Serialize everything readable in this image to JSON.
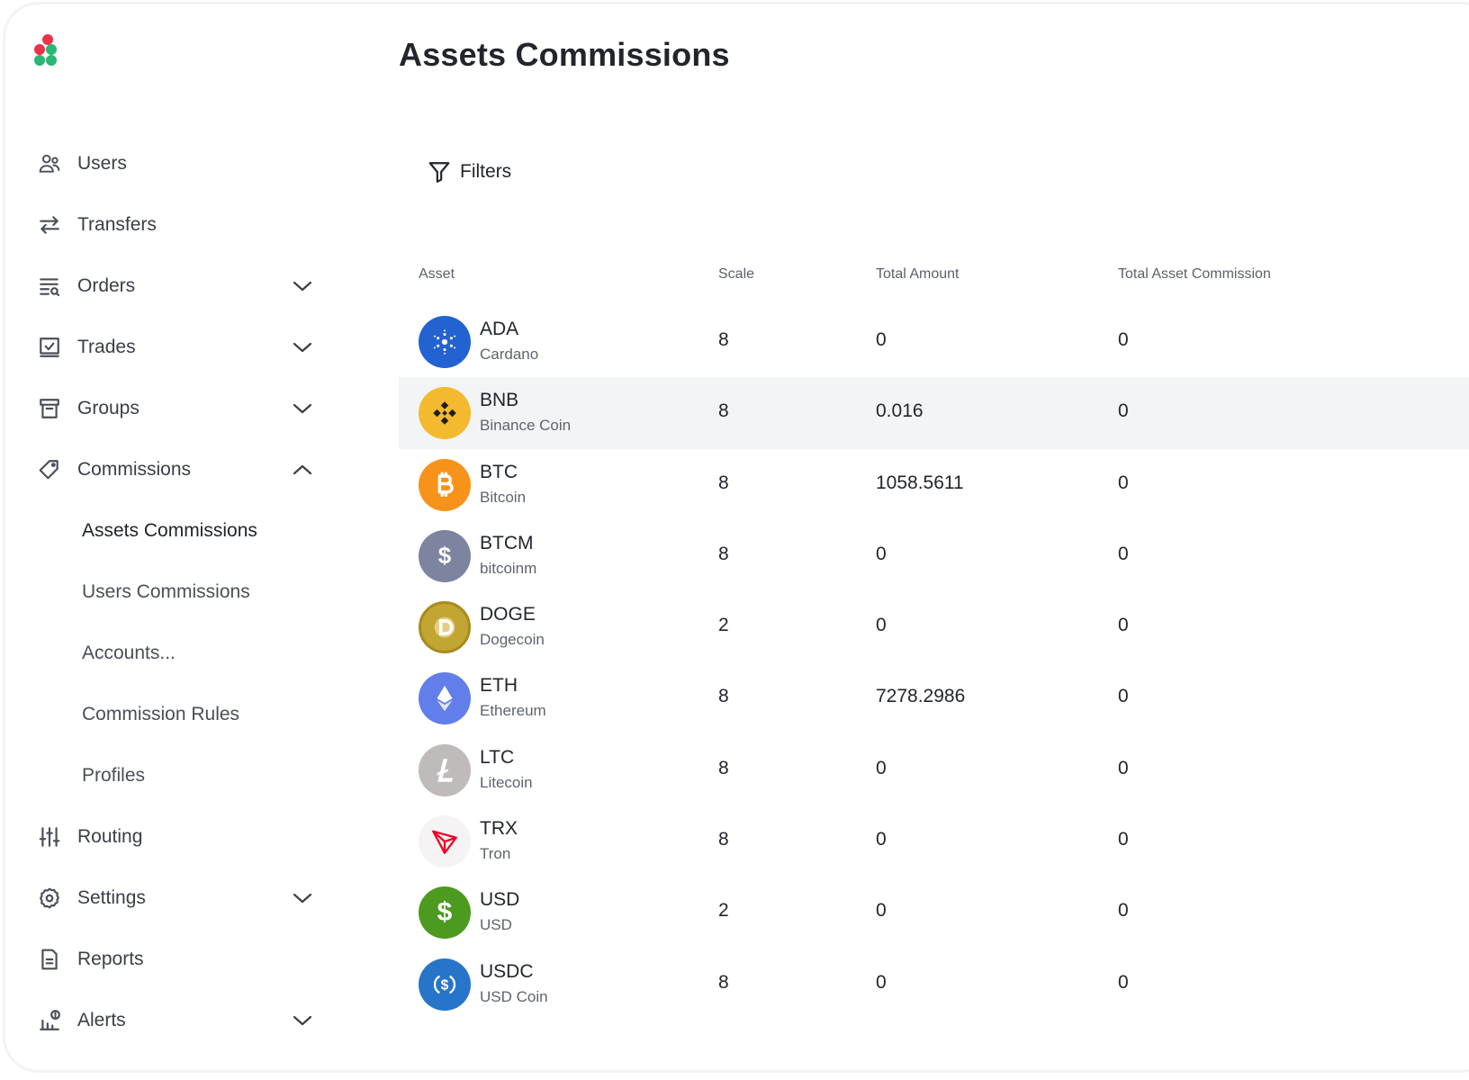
{
  "page": {
    "title": "Assets Commissions"
  },
  "sidebar": {
    "items": [
      {
        "label": "Users"
      },
      {
        "label": "Transfers"
      },
      {
        "label": "Orders"
      },
      {
        "label": "Trades"
      },
      {
        "label": "Groups"
      },
      {
        "label": "Commissions"
      },
      {
        "label": "Routing"
      },
      {
        "label": "Settings"
      },
      {
        "label": "Reports"
      },
      {
        "label": "Alerts"
      }
    ],
    "commissions_sub": [
      {
        "label": "Assets Commissions"
      },
      {
        "label": "Users Commissions"
      },
      {
        "label": "Accounts..."
      },
      {
        "label": "Commission Rules"
      },
      {
        "label": "Profiles"
      }
    ]
  },
  "filters": {
    "label": "Filters"
  },
  "table": {
    "headers": {
      "asset": "Asset",
      "scale": "Scale",
      "total_amount": "Total Amount",
      "total_commission": "Total Asset Commission"
    },
    "rows": [
      {
        "symbol": "ADA",
        "name": "Cardano",
        "scale": "8",
        "total_amount": "0",
        "commission": "0",
        "color": "#2362d1"
      },
      {
        "symbol": "BNB",
        "name": "Binance Coin",
        "scale": "8",
        "total_amount": "0.016",
        "commission": "0",
        "color": "#f3ba2f"
      },
      {
        "symbol": "BTC",
        "name": "Bitcoin",
        "scale": "8",
        "total_amount": "1058.5611",
        "commission": "0",
        "color": "#f7931a"
      },
      {
        "symbol": "BTCM",
        "name": "bitcoinm",
        "scale": "8",
        "total_amount": "0",
        "commission": "0",
        "color": "#7d84a0"
      },
      {
        "symbol": "DOGE",
        "name": "Dogecoin",
        "scale": "2",
        "total_amount": "0",
        "commission": "0",
        "color": "#c2a633"
      },
      {
        "symbol": "ETH",
        "name": "Ethereum",
        "scale": "8",
        "total_amount": "7278.2986",
        "commission": "0",
        "color": "#627eea"
      },
      {
        "symbol": "LTC",
        "name": "Litecoin",
        "scale": "8",
        "total_amount": "0",
        "commission": "0",
        "color": "#bfbbbb"
      },
      {
        "symbol": "TRX",
        "name": "Tron",
        "scale": "8",
        "total_amount": "0",
        "commission": "0",
        "color": "#ef0027"
      },
      {
        "symbol": "USD",
        "name": "USD",
        "scale": "2",
        "total_amount": "0",
        "commission": "0",
        "color": "#4c9a1f"
      },
      {
        "symbol": "USDC",
        "name": "USD Coin",
        "scale": "8",
        "total_amount": "0",
        "commission": "0",
        "color": "#2775ca"
      }
    ]
  },
  "colors": {
    "logo_red": "#e8334a",
    "logo_green": "#2bb673",
    "hover_row": "#f3f4f6"
  },
  "icons": [
    "users-icon",
    "transfers-icon",
    "orders-icon",
    "trades-icon",
    "groups-icon",
    "commissions-icon",
    "routing-icon",
    "settings-icon",
    "reports-icon",
    "alerts-icon",
    "filter-icon",
    "chevron-down-icon",
    "chevron-up-icon"
  ]
}
